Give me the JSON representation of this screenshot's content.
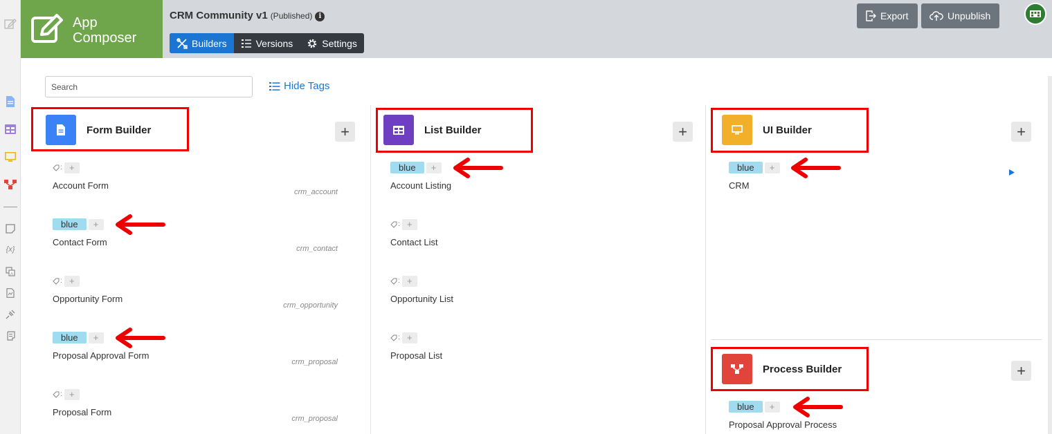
{
  "app": {
    "brand_line1": "App",
    "brand_line2": "Composer",
    "title": "CRM Community v1",
    "status": "(Published)",
    "info": "i"
  },
  "tabs": [
    {
      "label": "Builders",
      "icon": "tools-icon",
      "active": true
    },
    {
      "label": "Versions",
      "icon": "list-icon",
      "active": false
    },
    {
      "label": "Settings",
      "icon": "gear-icon",
      "active": false
    }
  ],
  "header_actions": {
    "export_label": "Export",
    "unpublish_label": "Unpublish"
  },
  "search": {
    "placeholder": "Search",
    "value": ""
  },
  "hide_tags_label": "Hide Tags",
  "tag_prefix": ":",
  "tag_add": "+",
  "add_symbol": "+",
  "builders": {
    "form": {
      "title": "Form Builder",
      "icon": "document-icon",
      "color": "#3b82f6",
      "items": [
        {
          "name": "Account Form",
          "id": "crm_account",
          "tag": ""
        },
        {
          "name": "Contact Form",
          "id": "crm_contact",
          "tag": "blue"
        },
        {
          "name": "Opportunity Form",
          "id": "crm_opportunity",
          "tag": ""
        },
        {
          "name": "Proposal Approval Form",
          "id": "crm_proposal",
          "tag": "blue"
        },
        {
          "name": "Proposal Form",
          "id": "crm_proposal",
          "tag": ""
        }
      ]
    },
    "list": {
      "title": "List Builder",
      "icon": "table-icon",
      "color": "#6f3fc1",
      "items": [
        {
          "name": "Account Listing",
          "tag": "blue"
        },
        {
          "name": "Contact List",
          "tag": ""
        },
        {
          "name": "Opportunity List",
          "tag": ""
        },
        {
          "name": "Proposal List",
          "tag": ""
        }
      ]
    },
    "ui": {
      "title": "UI Builder",
      "icon": "monitor-icon",
      "color": "#f2b02a",
      "items": [
        {
          "name": "CRM",
          "tag": "blue"
        }
      ]
    },
    "process": {
      "title": "Process Builder",
      "icon": "process-icon",
      "color": "#e0443a",
      "items": [
        {
          "name": "Proposal Approval Process",
          "tag": "blue"
        }
      ]
    }
  },
  "colors": {
    "brand_green": "#6fa64b",
    "header_bg": "#d4d8dd",
    "active_tab": "#1a76d2",
    "tabs_bg": "#343a40",
    "tag_blue": "#9fdcef",
    "highlight_red": "#e00000",
    "link_blue": "#1a76d2"
  }
}
